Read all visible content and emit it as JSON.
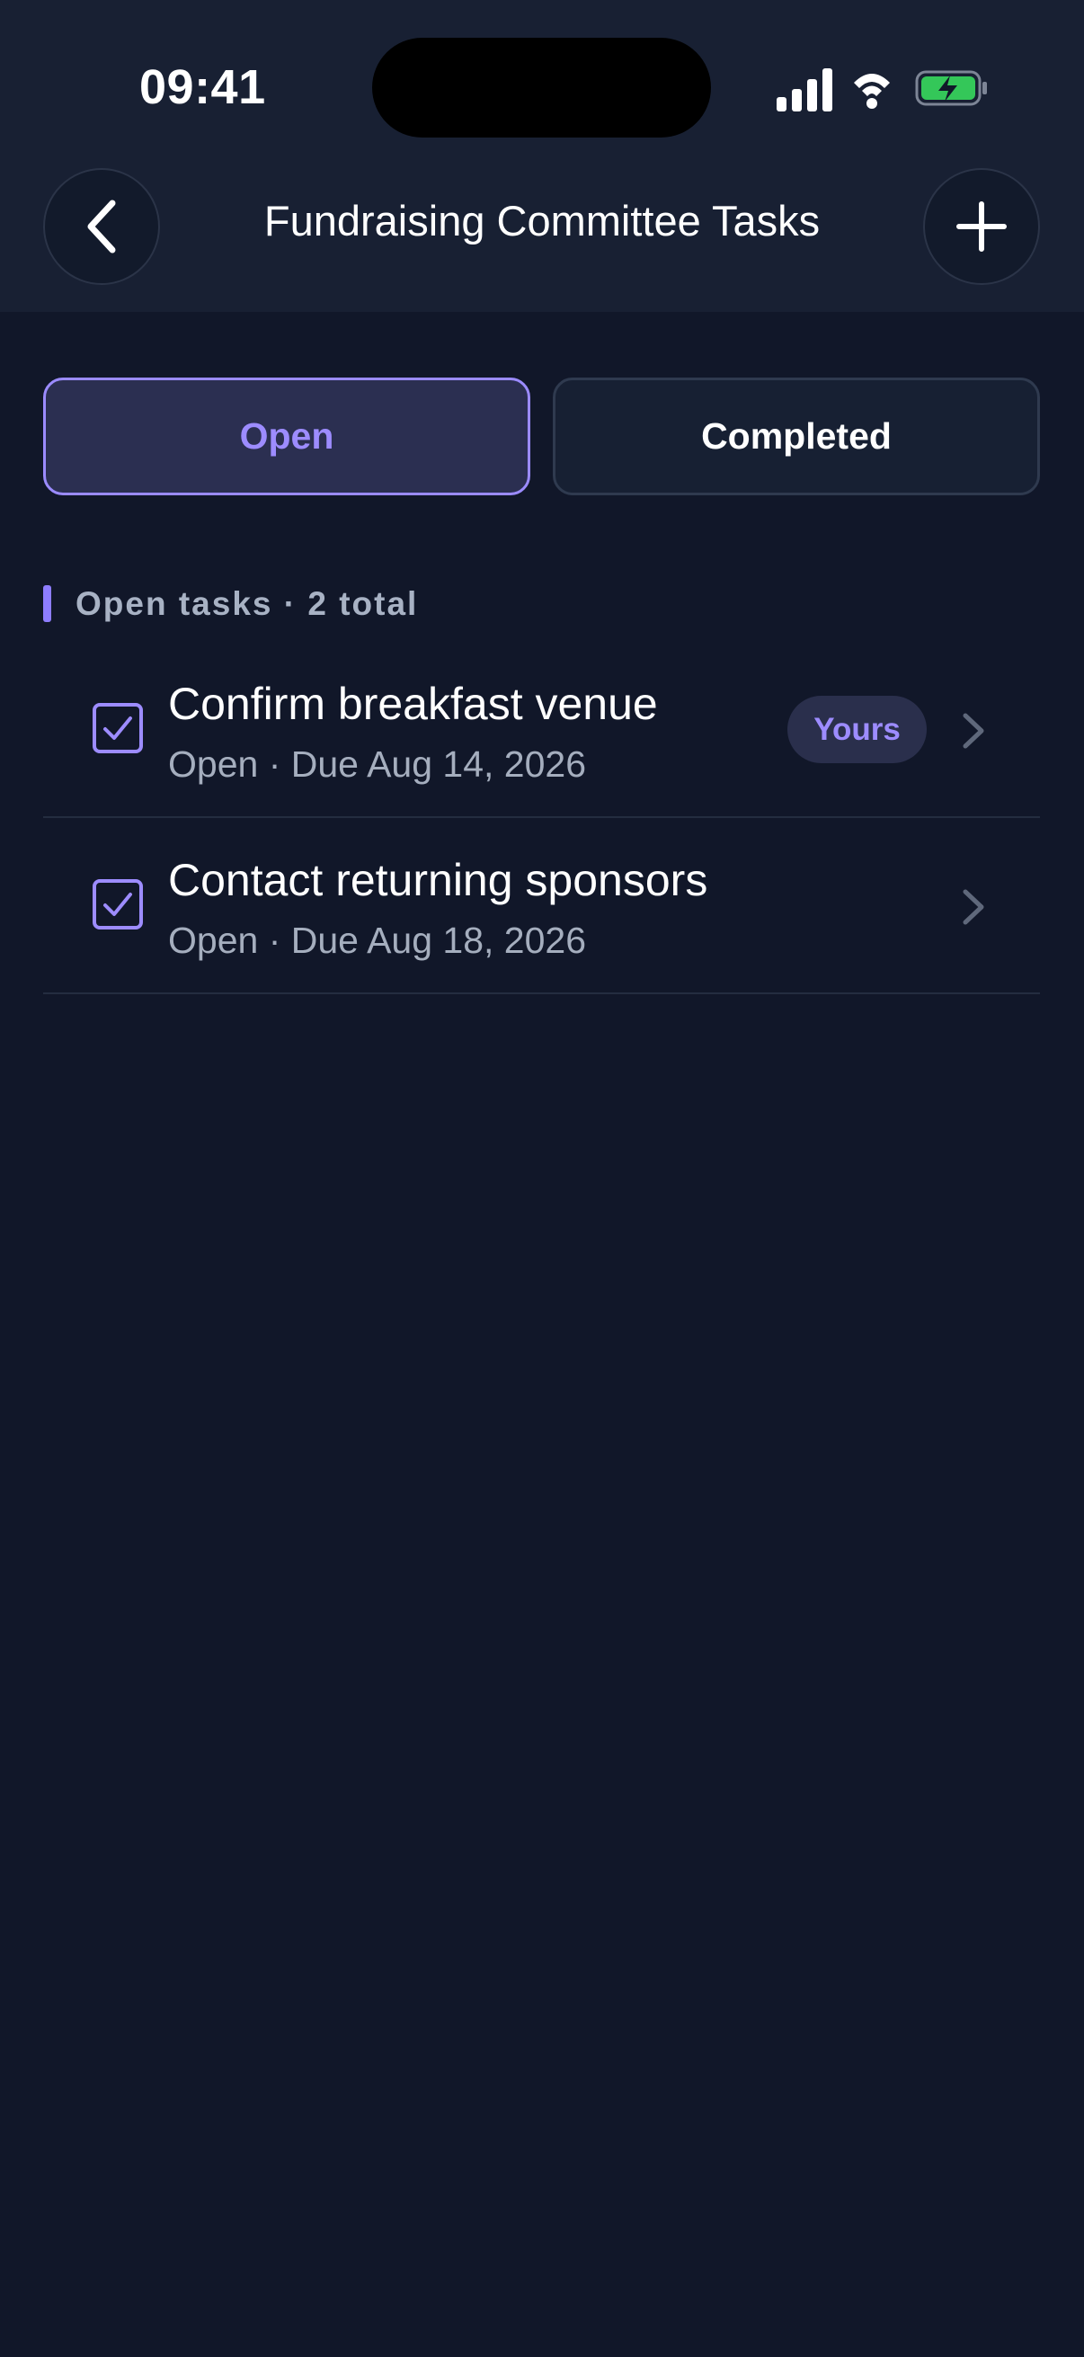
{
  "status_bar": {
    "time": "09:41",
    "icons": [
      "cellular-signal-icon",
      "wifi-icon",
      "battery-charging-icon"
    ],
    "battery_color": "#34c759"
  },
  "header": {
    "title": "Fundraising Committee Tasks",
    "back_icon": "chevron-left-icon",
    "add_icon": "plus-icon"
  },
  "tabs": [
    {
      "label": "Open",
      "selected": true
    },
    {
      "label": "Completed",
      "selected": false
    }
  ],
  "section": {
    "label": "Open tasks · 2 total"
  },
  "tasks": [
    {
      "title": "Confirm breakfast venue",
      "meta": "Open · Due Aug 14, 2026",
      "badge": "Yours"
    },
    {
      "title": "Contact returning sponsors",
      "meta": "Open · Due Aug 18, 2026",
      "badge": null
    }
  ],
  "colors": {
    "background": "#111729",
    "header": "#182033",
    "accent": "#9d8cff",
    "muted_text": "#a5aebe"
  }
}
